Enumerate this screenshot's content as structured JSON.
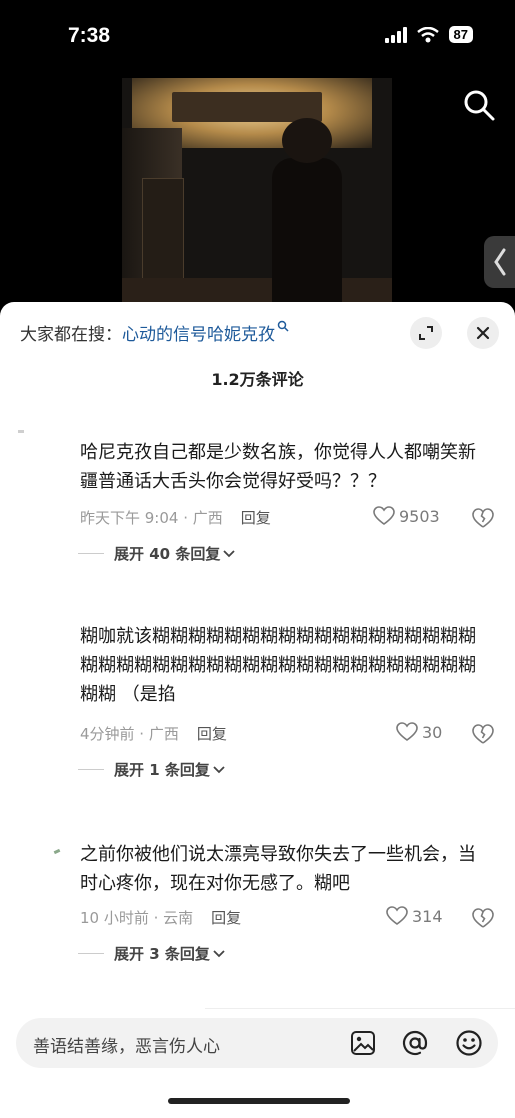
{
  "status_bar": {
    "time": "7:38",
    "battery": "87"
  },
  "search": {
    "prefix": "大家都在搜：",
    "term": "心动的信号哈妮克孜"
  },
  "comment_count": "1.2万条评论",
  "comments": [
    {
      "text": "哈尼克孜自己都是少数名族，你觉得人人都嘲笑新疆普通话大舌头你会觉得好受吗？？？",
      "meta": "昨天下午 9:04 · 广西",
      "reply": "回复",
      "likes": "9503",
      "expand": "展开 40 条回复"
    },
    {
      "text": "糊咖就该糊糊糊糊糊糊糊糊糊糊糊糊糊糊糊糊糊糊糊糊糊糊糊糊糊糊糊糊糊糊糊糊糊糊糊糊糊糊糊糊糊糊 （是掐",
      "meta": "4分钟前 · 广西",
      "reply": "回复",
      "likes": "30",
      "expand": "展开 1 条回复"
    },
    {
      "text": "之前你被他们说太漂亮导致你失去了一些机会，当时心疼你，现在对你无感了。糊吧",
      "meta": "10 小时前 · 云南",
      "reply": "回复",
      "likes": "314",
      "expand": "展开 3 条回复"
    }
  ],
  "input": {
    "placeholder": "善语结善缘，恶言伤人心"
  },
  "icons": [
    "search-icon",
    "side-arrow-icon",
    "expand-icon",
    "close-icon",
    "heart-icon",
    "broken-heart-icon",
    "image-icon",
    "at-icon",
    "emoji-icon"
  ]
}
